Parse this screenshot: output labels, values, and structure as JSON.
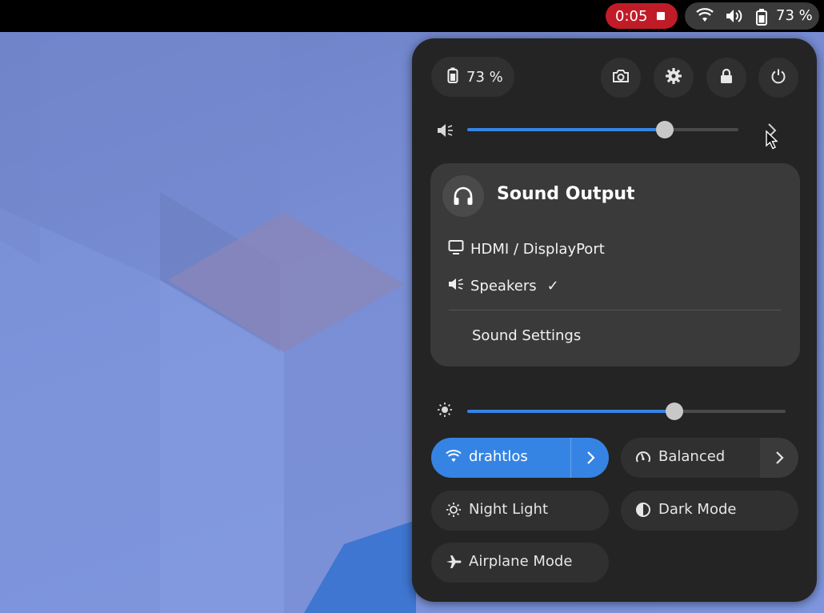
{
  "topbar": {
    "recording_time": "0:05",
    "battery_percent": "73 %",
    "icons": [
      "wifi-icon",
      "volume-icon",
      "battery-icon"
    ],
    "record_color": "#c01c28"
  },
  "quick_settings": {
    "battery_label": "73 %",
    "buttons": [
      "screenshot-icon",
      "settings-icon",
      "lock-icon",
      "power-icon"
    ],
    "volume_level": 0.73,
    "brightness_level": 0.65,
    "accent_color": "#3584e4",
    "sound_output": {
      "title": "Sound Output",
      "devices": [
        {
          "label": "HDMI / DisplayPort",
          "icon": "monitor-icon",
          "selected": false
        },
        {
          "label": "Speakers",
          "icon": "speaker-icon",
          "selected": true,
          "check": "✓"
        }
      ],
      "settings_label": "Sound Settings"
    },
    "toggles": [
      {
        "label": "drahtlos",
        "icon": "wifi-icon",
        "active": true,
        "has_menu": true
      },
      {
        "label": "Balanced",
        "icon": "power-profile-icon",
        "active": false,
        "has_menu": true
      },
      {
        "label": "Night Light",
        "icon": "night-light-icon",
        "active": false
      },
      {
        "label": "Dark Mode",
        "icon": "dark-mode-icon",
        "active": false
      },
      {
        "label": "Airplane Mode",
        "icon": "airplane-icon",
        "active": false
      }
    ]
  }
}
